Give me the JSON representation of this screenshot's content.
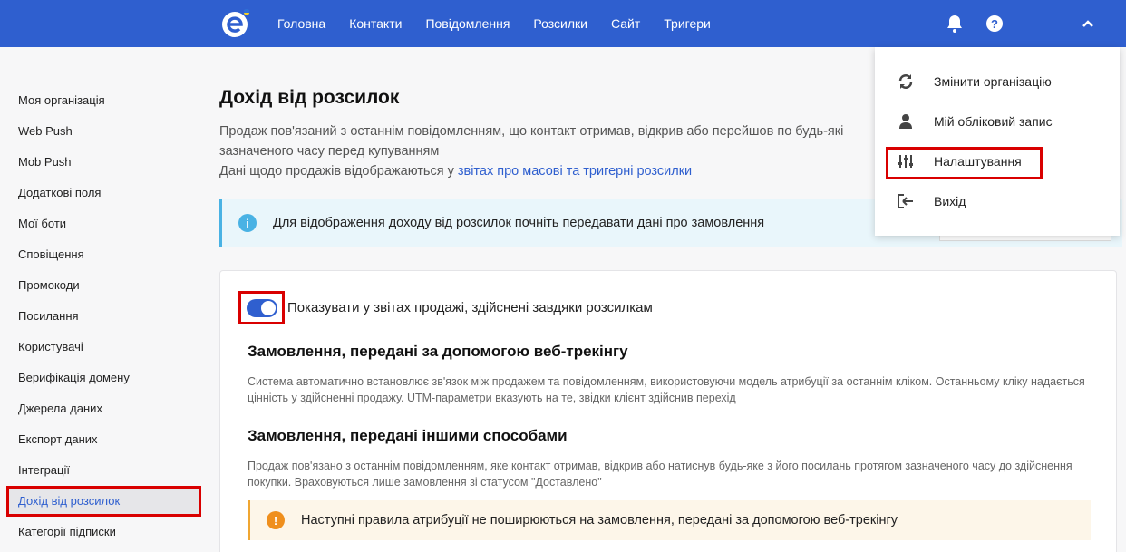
{
  "nav": {
    "items": [
      "Головна",
      "Контакти",
      "Повідомлення",
      "Розсилки",
      "Сайт",
      "Тригери"
    ],
    "icons": [
      "bell-icon",
      "help-icon",
      "chevron-up-icon"
    ]
  },
  "sidebar": {
    "items": [
      {
        "label": "Моя організація"
      },
      {
        "label": "Web Push"
      },
      {
        "label": "Mob Push"
      },
      {
        "label": "Додаткові поля"
      },
      {
        "label": "Мої боти"
      },
      {
        "label": "Сповіщення"
      },
      {
        "label": "Промокоди"
      },
      {
        "label": "Посилання"
      },
      {
        "label": "Користувачі"
      },
      {
        "label": "Верифікація домену"
      },
      {
        "label": "Джерела даних"
      },
      {
        "label": "Експорт даних"
      },
      {
        "label": "Інтеграції"
      },
      {
        "label": "Дохід від розсилок",
        "active": true
      },
      {
        "label": "Категорії підписки"
      }
    ]
  },
  "main": {
    "title": "Дохід від розсилок",
    "intro_line1": "Продаж пов'язаний з останнім повідомленням, що контакт отримав, відкрив або перейшов по будь-які",
    "intro_line2": "зазначеного часу перед купуванням",
    "intro_line3_prefix": "Дані щодо продажів відображаються у ",
    "intro_link": "звітах про масові та тригерні розсилки",
    "info": "Для відображення доходу від розсилок почніть передавати дані про замовлення",
    "toggle_label": "Показувати у звітах продажі, здійснені завдяки розсилкам",
    "toggle_on": true,
    "section1_title": "Замовлення, передані за допомогою веб-трекінгу",
    "section1_text": "Система автоматично встановлює зв'язок між продажем та повідомленням, використовуючи модель атрибуції за останнім кліком. Останньому кліку надається цінність у здійсненні продажу. UTM-параметри вказують на те, звідки клієнт здійснив перехід",
    "section2_title": "Замовлення, передані іншими способами",
    "section2_text": "Продаж пов'язано з останнім повідомленням, яке контакт отримав, відкрив або натиснув будь-яке з його посилань протягом зазначеного часу до здійснення покупки. Враховуються лише замовлення зі статусом \"Доставлено\"",
    "warning": "Наступні правила атрибуції не поширюються на замовлення, передані за допомогою веб-трекінгу"
  },
  "dropdown": {
    "items": [
      {
        "label": "Змінити організацію",
        "icon": "refresh-icon"
      },
      {
        "label": "Мій обліковий запис",
        "icon": "user-icon"
      },
      {
        "label": "Налаштування",
        "icon": "sliders-icon",
        "highlighted": true
      },
      {
        "label": "Вихід",
        "icon": "logout-icon"
      }
    ]
  },
  "colors": {
    "brand": "#2f5fcf",
    "info": "#49b2e4",
    "warning": "#ef8f1d",
    "highlight": "#d90000"
  }
}
